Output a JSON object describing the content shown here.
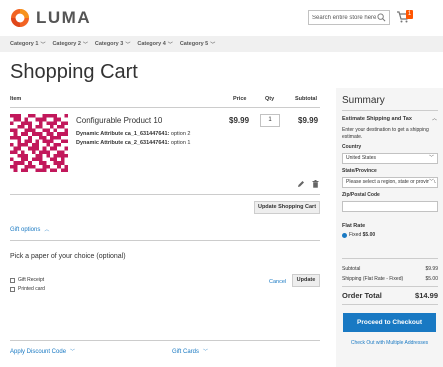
{
  "header": {
    "logo_text": "LUMA",
    "search_placeholder": "Search entire store here...",
    "cart_count": "1"
  },
  "nav": {
    "items": [
      "Category 1",
      "Category 2",
      "Category 3",
      "Category 4",
      "Category 5"
    ]
  },
  "page_title": "Shopping Cart",
  "cart": {
    "columns": {
      "item": "Item",
      "price": "Price",
      "qty": "Qty",
      "subtotal": "Subtotal"
    },
    "product": {
      "name": "Configurable Product 10",
      "attr1_label": "Dynamic Attribute ca_1_631447641:",
      "attr1_value": "option 2",
      "attr2_label": "Dynamic Attribute ca_2_631447641:",
      "attr2_value": "option 1",
      "price": "$9.99",
      "qty": "1",
      "subtotal": "$9.99"
    },
    "update_cart_label": "Update Shopping Cart"
  },
  "gift": {
    "title": "Gift options",
    "paper_text": "Pick a paper of your choice (optional)",
    "receipt_label": "Gift Receipt",
    "printed_card_label": "Printed card",
    "cancel_label": "Cancel",
    "update_label": "Update"
  },
  "bottom": {
    "discount_label": "Apply Discount Code",
    "giftcards_label": "Gift Cards"
  },
  "summary": {
    "title": "Summary",
    "estimate_title": "Estimate Shipping and Tax",
    "estimate_desc": "Enter your destination to get a shipping estimate.",
    "country_label": "Country",
    "country_value": "United States",
    "state_label": "State/Province",
    "state_value": "Please select a region, state or province.",
    "zip_label": "Zip/Postal Code",
    "zip_value": "",
    "flat_rate_title": "Flat Rate",
    "fixed_label": "Fixed",
    "fixed_price": "$5.00",
    "subtotal_label": "Subtotal",
    "subtotal_value": "$9.99",
    "shipping_label": "Shipping (Flat Rate - Fixed)",
    "shipping_value": "$5.00",
    "order_total_label": "Order Total",
    "order_total_value": "$14.99",
    "checkout_label": "Proceed to Checkout",
    "multi_label": "Check Out with Multiple Addresses"
  },
  "colors": {
    "accent": "#1979c3",
    "logo_orange": "#f26322",
    "badge": "#ff5501"
  }
}
